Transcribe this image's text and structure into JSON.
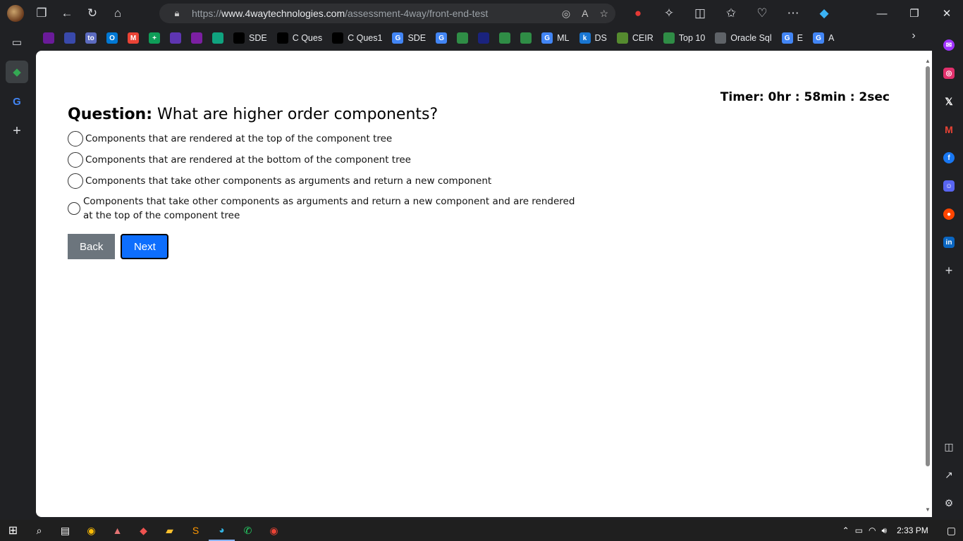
{
  "browser": {
    "url_prefix": "https://",
    "url_domain": "www.4waytechnologies.com",
    "url_path": "/assessment-4way/front-end-test",
    "window_controls": {
      "minimize": "—",
      "maximize": "❐",
      "close": "✕"
    }
  },
  "bookmarks": [
    {
      "label": "",
      "icon": "app-icon-1",
      "color": "#6a1b9a"
    },
    {
      "label": "",
      "icon": "app-icon-2",
      "color": "#3949ab"
    },
    {
      "label": "",
      "icon": "to-icon",
      "color": "#5c6bc0",
      "glyph": "to"
    },
    {
      "label": "",
      "icon": "outlook-icon",
      "color": "#0078d4",
      "glyph": "O"
    },
    {
      "label": "",
      "icon": "gmail-icon",
      "color": "#ea4335",
      "glyph": "M"
    },
    {
      "label": "",
      "icon": "sheets-icon",
      "color": "#0f9d58",
      "glyph": "+"
    },
    {
      "label": "",
      "icon": "app-icon-3",
      "color": "#5e35b1"
    },
    {
      "label": "",
      "icon": "app-icon-4",
      "color": "#7b1fa2"
    },
    {
      "label": "",
      "icon": "chatgpt-icon",
      "color": "#10a37f"
    },
    {
      "label": "SDE",
      "icon": "github-icon",
      "color": "#000000"
    },
    {
      "label": "C Ques",
      "icon": "github-icon",
      "color": "#000000"
    },
    {
      "label": "C Ques1",
      "icon": "github-icon",
      "color": "#000000"
    },
    {
      "label": "SDE",
      "icon": "google-icon",
      "color": "#4285f4",
      "glyph": "G"
    },
    {
      "label": "",
      "icon": "google-icon",
      "color": "#4285f4",
      "glyph": "G"
    },
    {
      "label": "",
      "icon": "gfg-icon",
      "color": "#2f8d46"
    },
    {
      "label": "",
      "icon": "app-icon-5",
      "color": "#1a237e"
    },
    {
      "label": "",
      "icon": "gfg-icon",
      "color": "#2f8d46"
    },
    {
      "label": "",
      "icon": "gfg-icon",
      "color": "#2f8d46"
    },
    {
      "label": "ML",
      "icon": "google-icon",
      "color": "#4285f4",
      "glyph": "G"
    },
    {
      "label": "DS",
      "icon": "k-icon",
      "color": "#1976d2",
      "glyph": "k"
    },
    {
      "label": "CEIR",
      "icon": "ceir-icon",
      "color": "#558b2f"
    },
    {
      "label": "Top 10",
      "icon": "gfg-icon",
      "color": "#2f8d46"
    },
    {
      "label": "Oracle Sql",
      "icon": "page-icon",
      "color": "#5f6368"
    },
    {
      "label": "E",
      "icon": "google-icon",
      "color": "#4285f4",
      "glyph": "G"
    },
    {
      "label": "A",
      "icon": "google-icon",
      "color": "#4285f4",
      "glyph": "G"
    }
  ],
  "content": {
    "timer": "Timer: 0hr : 58min : 2sec",
    "question_label": "Question:",
    "question_text": "What are higher order components?",
    "options": [
      "Components that are rendered at the top of the component tree",
      "Components that are rendered at the bottom of the component tree",
      "Components that take other components as arguments and return a new component",
      "Components that take other components as arguments and return a new component and are rendered at the top of the component tree"
    ],
    "back_label": "Back",
    "next_label": "Next"
  },
  "taskbar": {
    "time": "2:33 PM"
  },
  "colors": {
    "primary_button": "#0d6efd",
    "secondary_button": "#6c757d",
    "browser_chrome": "#202124"
  }
}
